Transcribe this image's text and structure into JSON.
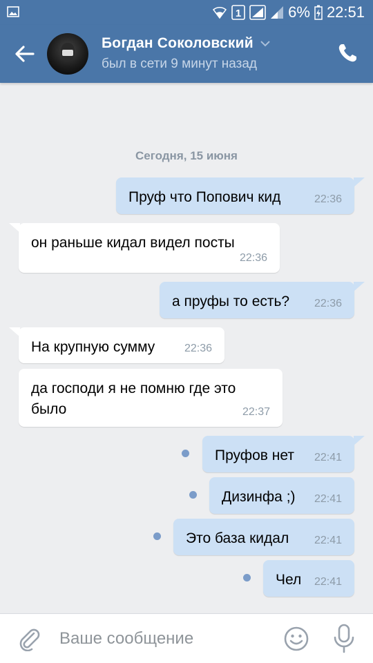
{
  "status_bar": {
    "battery": "6%",
    "time": "22:51",
    "sim_badge": "1",
    "icons": [
      "image-icon",
      "wifi-icon",
      "sim-signal-icon",
      "signal-icon",
      "battery-charging-icon"
    ]
  },
  "header": {
    "contact_name": "Богдан Соколовский",
    "presence": "был в сети 9 минут назад",
    "color": "#4a76a8"
  },
  "chat": {
    "date_separator": "Сегодня, 15 июня",
    "messages": [
      {
        "dir": "out",
        "text": "Пруф что Попович кид",
        "time": "22:36"
      },
      {
        "dir": "in",
        "text": "он раньше кидал видел посты",
        "time": "22:36"
      },
      {
        "dir": "out",
        "text": "а пруфы то есть?",
        "time": "22:36"
      },
      {
        "dir": "in",
        "text": "На крупную сумму",
        "time": "22:36"
      },
      {
        "dir": "in",
        "text": "да господи я не помню где это было",
        "time": "22:37"
      },
      {
        "dir": "out",
        "text": "Пруфов нет",
        "time": "22:41",
        "unread": true
      },
      {
        "dir": "out",
        "text": "Дизинфа ;)",
        "time": "22:41",
        "unread": true
      },
      {
        "dir": "out",
        "text": "Это база кидал",
        "time": "22:41",
        "unread": true
      },
      {
        "dir": "out",
        "text": "Чел",
        "time": "22:41",
        "unread": true
      }
    ]
  },
  "input": {
    "placeholder": "Ваше сообщение",
    "value": ""
  },
  "colors": {
    "outgoing_bubble": "#cce0f5",
    "incoming_bubble": "#ffffff",
    "background": "#edeef0",
    "unread_dot": "#7b9cc9"
  }
}
